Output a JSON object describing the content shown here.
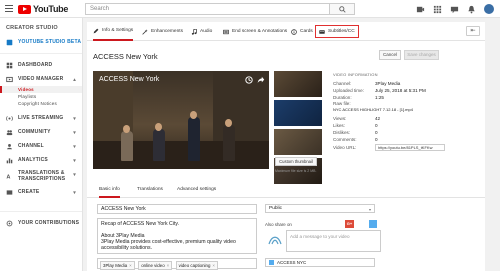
{
  "header": {
    "logo_text": "YouTube",
    "search_placeholder": "Search"
  },
  "sidebar": {
    "title": "CREATOR STUDIO",
    "items": [
      {
        "label": "YOUTUBE STUDIO BETA"
      },
      {
        "label": "DASHBOARD"
      },
      {
        "label": "VIDEO MANAGER"
      },
      {
        "label": "LIVE STREAMING"
      },
      {
        "label": "COMMUNITY"
      },
      {
        "label": "CHANNEL"
      },
      {
        "label": "ANALYTICS"
      },
      {
        "label": "TRANSLATIONS & TRANSCRIPTIONS"
      },
      {
        "label": "CREATE"
      },
      {
        "label": "YOUR CONTRIBUTIONS"
      }
    ],
    "video_manager_sub": [
      "Videos",
      "Playlists",
      "Copyright Notices"
    ]
  },
  "tabs": [
    "Info & Settings",
    "Enhancements",
    "Audio",
    "End screen & Annotations",
    "Cards",
    "Subtitles/CC"
  ],
  "video": {
    "title": "ACCESS New York",
    "player_title": "ACCESS New York",
    "cancel": "Cancel",
    "save": "Save changes",
    "thumb_label": "ACCESS",
    "custom_thumb": "Custom thumbnail",
    "thumb_note": "Maximum file size is 2 MB."
  },
  "info": {
    "heading": "VIDEO INFORMATION",
    "channel_k": "Channel:",
    "channel_v": "3Play Media",
    "uploaded_k": "Uploaded time:",
    "uploaded_v": "July 25, 2018 at 5:31 PM",
    "duration_k": "Duration:",
    "duration_v": "1:25",
    "rawfile_k": "Raw file:",
    "rawfile_v": "NYC ACCESS HIGHLIGHT 7.12.18 - [1].mp4",
    "views_k": "Views:",
    "views_v": "42",
    "likes_k": "Likes:",
    "likes_v": "0",
    "dislikes_k": "Dislikes:",
    "dislikes_v": "0",
    "comments_k": "Comments:",
    "comments_v": "0",
    "url_k": "Video URL:",
    "url_v": "https://youtu.be/81PLS_tKFKw"
  },
  "basic_tabs": [
    "Basic info",
    "Translations",
    "Advanced settings"
  ],
  "form": {
    "title_value": "ACCESS New York",
    "description": "Recap of ACCESS New York City.\n\nAbout 3Play Media\n3Play Media provides cost-effective, premium quality video accessibility solutions.",
    "tags": [
      "3Play Media",
      "online video",
      "video captioning"
    ],
    "privacy": "Public",
    "also_share": "Also share on",
    "gplus": "G+",
    "share_placeholder": "Add a message to your video",
    "channel_tag": "ACCESS NYC"
  }
}
